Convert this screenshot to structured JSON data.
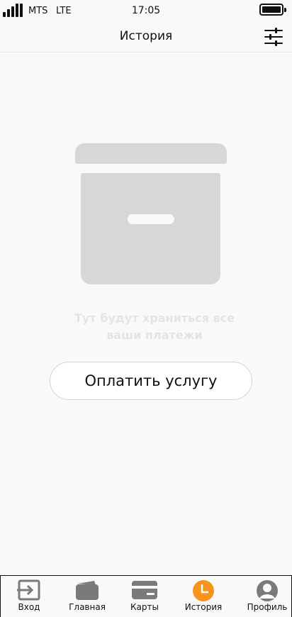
{
  "status_bar": {
    "carrier": "MTS",
    "network": "LTE",
    "time": "17:05"
  },
  "header": {
    "title": "История",
    "filter_icon": "sliders-icon"
  },
  "empty_state": {
    "icon": "archive-box-icon",
    "text": "Тут будут храниться все ваши платежи",
    "color": "#d7d7d7"
  },
  "pay_button": {
    "label": "Оплатить услугу"
  },
  "tabs": [
    {
      "label": "Вход",
      "icon": "login-icon",
      "active": false
    },
    {
      "label": "Главная",
      "icon": "wallet-icon",
      "active": false
    },
    {
      "label": "Карты",
      "icon": "card-icon",
      "active": false
    },
    {
      "label": "История",
      "icon": "clock-icon",
      "active": true
    },
    {
      "label": "Профиль",
      "icon": "profile-icon",
      "active": false
    }
  ],
  "colors": {
    "accent": "#f7941d",
    "icon_gray": "#7a7a7a"
  }
}
